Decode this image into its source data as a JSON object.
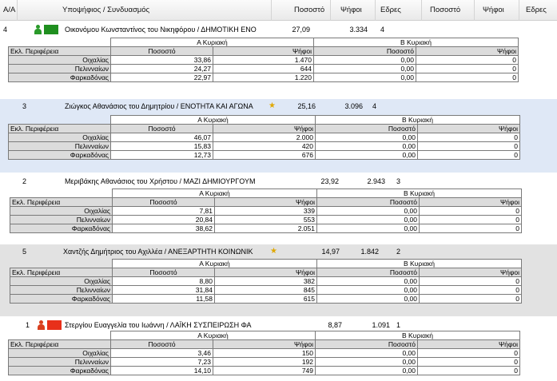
{
  "header": {
    "aa": "Α/Α",
    "candidate": "Υποψήφιος / Συνδυασμός",
    "pct": "Ποσοστό",
    "votes": "Ψήφοι",
    "seats": "Εδρες",
    "pct2": "Ποσοστό",
    "votes2": "Ψήφοι",
    "seats2": "Εδρες"
  },
  "sub_headers": {
    "round_a": "Α Κυριακή",
    "round_b": "Β Κυριακή",
    "region": "Εκλ. Περιφέρεια",
    "pct": "Ποσοστό",
    "votes": "Ψήφοι"
  },
  "candidates": [
    {
      "aa": "4",
      "name": "Οικονόμου Κωνσταντίνος του Νικηφόρου / ΔΗΜΟΤΙΚΗ ΕΝΟ",
      "pct": "27,09",
      "votes": "3.334",
      "seats": "4",
      "icon_color": "#2a9a2a",
      "swatch_color": "#1f8f1f",
      "star": "",
      "highlight": false,
      "rows": [
        {
          "region": "Οιχαλίας",
          "pct_a": "33,86",
          "votes_a": "1.470",
          "pct_b": "0,00",
          "votes_b": "0"
        },
        {
          "region": "Πελινναίων",
          "pct_a": "24,27",
          "votes_a": "644",
          "pct_b": "0,00",
          "votes_b": "0"
        },
        {
          "region": "Φαρκαδόνας",
          "pct_a": "22,97",
          "votes_a": "1.220",
          "pct_b": "0,00",
          "votes_b": "0"
        }
      ]
    },
    {
      "aa": "3",
      "name": "Ζιώγκος Αθανάσιος του Δημητρίου / ΕΝΟΤΗΤΑ ΚΑΙ ΑΓΩΝΑ",
      "pct": "25,16",
      "votes": "3.096",
      "seats": "4",
      "icon_color": "",
      "swatch_color": "",
      "star": "★",
      "highlight": true,
      "rows": [
        {
          "region": "Οιχαλίας",
          "pct_a": "46,07",
          "votes_a": "2.000",
          "pct_b": "0,00",
          "votes_b": "0"
        },
        {
          "region": "Πελινναίων",
          "pct_a": "15,83",
          "votes_a": "420",
          "pct_b": "0,00",
          "votes_b": "0"
        },
        {
          "region": "Φαρκαδόνας",
          "pct_a": "12,73",
          "votes_a": "676",
          "pct_b": "0,00",
          "votes_b": "0"
        }
      ]
    },
    {
      "aa": "2",
      "name": "Μεριβάκης Αθανάσιος του Χρήστου / ΜΑΖΙ ΔΗΜΙΟΥΡΓΟΥΜ",
      "pct": "23,92",
      "votes": "2.943",
      "seats": "3",
      "icon_color": "",
      "swatch_color": "",
      "star": "",
      "highlight": false,
      "rows": [
        {
          "region": "Οιχαλίας",
          "pct_a": "7,81",
          "votes_a": "339",
          "pct_b": "0,00",
          "votes_b": "0"
        },
        {
          "region": "Πελινναίων",
          "pct_a": "20,84",
          "votes_a": "553",
          "pct_b": "0,00",
          "votes_b": "0"
        },
        {
          "region": "Φαρκαδόνας",
          "pct_a": "38,62",
          "votes_a": "2.051",
          "pct_b": "0,00",
          "votes_b": "0"
        }
      ]
    },
    {
      "aa": "5",
      "name": "Χαντζής Δημήτριος του Αχιλλέα / ΑΝΕΞΑΡΤΗΤΗ ΚΟΙΝΩΝΙΚ",
      "pct": "14,97",
      "votes": "1.842",
      "seats": "2",
      "icon_color": "",
      "swatch_color": "",
      "star": "★",
      "highlight": true,
      "rows": [
        {
          "region": "Οιχαλίας",
          "pct_a": "8,80",
          "votes_a": "382",
          "pct_b": "0,00",
          "votes_b": "0"
        },
        {
          "region": "Πελινναίων",
          "pct_a": "31,84",
          "votes_a": "845",
          "pct_b": "0,00",
          "votes_b": "0"
        },
        {
          "region": "Φαρκαδόνας",
          "pct_a": "11,58",
          "votes_a": "615",
          "pct_b": "0,00",
          "votes_b": "0"
        }
      ]
    },
    {
      "aa": "1",
      "name": "Στεργίου Ευαγγελία του Ιωάννη / ΛΑΪΚΗ ΣΥΣΠΕΙΡΩΣΗ ΦΑ",
      "pct": "8,87",
      "votes": "1.091",
      "seats": "1",
      "icon_color": "#d9401f",
      "swatch_color": "#e8301a",
      "star": "",
      "highlight": false,
      "rows": [
        {
          "region": "Οιχαλίας",
          "pct_a": "3,46",
          "votes_a": "150",
          "pct_b": "0,00",
          "votes_b": "0"
        },
        {
          "region": "Πελινναίων",
          "pct_a": "7,23",
          "votes_a": "192",
          "pct_b": "0,00",
          "votes_b": "0"
        },
        {
          "region": "Φαρκαδόνας",
          "pct_a": "14,10",
          "votes_a": "749",
          "pct_b": "0,00",
          "votes_b": "0"
        }
      ]
    }
  ],
  "colors": {
    "row_highlight_blue": "#dfe8f6",
    "row_highlight_gray": "#e2e2e2",
    "sub_header_bg": "#dcdcdc"
  }
}
